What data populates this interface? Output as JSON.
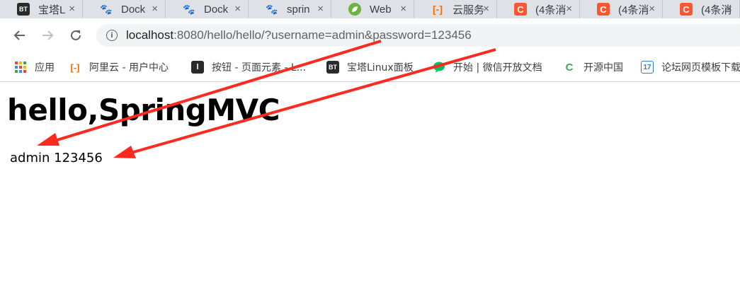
{
  "tabs": [
    {
      "icon": "BT",
      "title": "宝塔L"
    },
    {
      "icon": "du",
      "title": "Dock"
    },
    {
      "icon": "du",
      "title": "Dock"
    },
    {
      "icon": "du",
      "title": "sprin"
    },
    {
      "icon": "spring-leaf",
      "title": "Web"
    },
    {
      "icon": "[-]",
      "title": "云服务"
    },
    {
      "icon": "C",
      "title": "(4条消"
    },
    {
      "icon": "C",
      "title": "(4条消"
    },
    {
      "icon": "C",
      "title": "(4条消"
    }
  ],
  "tab_close_glyph": "×",
  "address_bar": {
    "host": "localhost",
    "rest": ":8080/hello/hello/?username=admin&password=123456"
  },
  "bookmarks": [
    {
      "icon": "apps-grid",
      "label": "应用"
    },
    {
      "icon": "[-]",
      "label": "阿里云 - 用户中心"
    },
    {
      "icon": "layui",
      "label": "按钮 - 页面元素 - L..."
    },
    {
      "icon": "BT",
      "label": "宝塔Linux面板"
    },
    {
      "icon": "wechat",
      "label": "开始 | 微信开放文档"
    },
    {
      "icon": "C",
      "label": "开源中国"
    },
    {
      "icon": "17",
      "label": "论坛网页模板下载"
    }
  ],
  "page": {
    "heading": "hello,SpringMVC",
    "result": "admin 123456"
  },
  "colors": {
    "annotation_arrow": "#ff2a1f",
    "tabstrip_bg": "#dee1e6",
    "omnibox_bg": "#f1f3f4"
  }
}
